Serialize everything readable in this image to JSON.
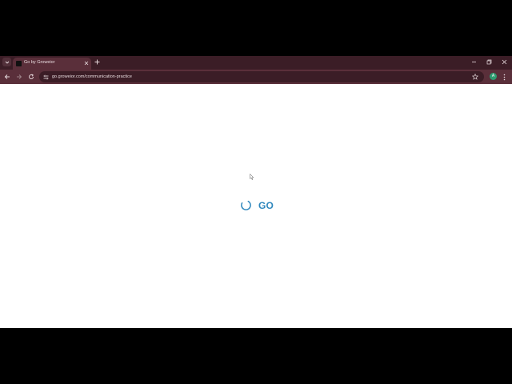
{
  "browser": {
    "tab": {
      "title": "Go by Groweior"
    },
    "address_bar": {
      "url": "go.groweior.com/communication-practice"
    },
    "profile": {
      "initial": "A"
    }
  },
  "page": {
    "loader_text": "GO"
  },
  "colors": {
    "tabstrip": "#3b1d26",
    "toolbar": "#5a2f3a",
    "accent": "#2f87bd",
    "avatar": "#2e9b70"
  },
  "icons": [
    "tab-search-icon",
    "close-icon",
    "plus-icon",
    "minimize-icon",
    "restore-icon",
    "back-arrow-icon",
    "forward-arrow-icon",
    "reload-icon",
    "site-info-icon",
    "star-icon",
    "kebab-menu-icon",
    "loading-spinner-icon",
    "mouse-cursor-icon"
  ]
}
